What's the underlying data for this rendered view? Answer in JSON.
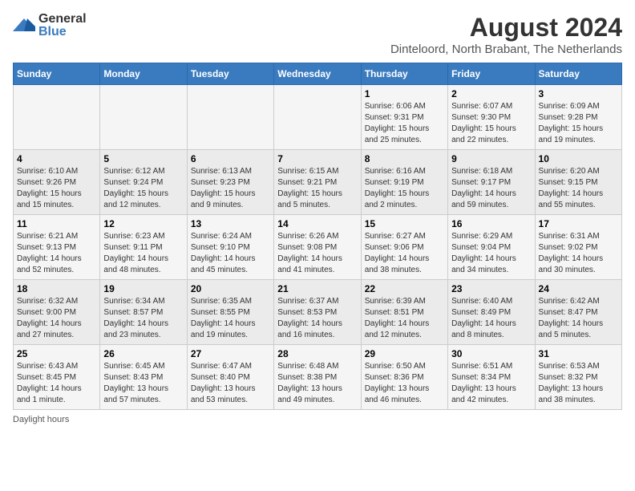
{
  "logo": {
    "general": "General",
    "blue": "Blue"
  },
  "title": "August 2024",
  "subtitle": "Dinteloord, North Brabant, The Netherlands",
  "weekdays": [
    "Sunday",
    "Monday",
    "Tuesday",
    "Wednesday",
    "Thursday",
    "Friday",
    "Saturday"
  ],
  "weeks": [
    [
      {
        "day": "",
        "info": ""
      },
      {
        "day": "",
        "info": ""
      },
      {
        "day": "",
        "info": ""
      },
      {
        "day": "",
        "info": ""
      },
      {
        "day": "1",
        "info": "Sunrise: 6:06 AM\nSunset: 9:31 PM\nDaylight: 15 hours and 25 minutes."
      },
      {
        "day": "2",
        "info": "Sunrise: 6:07 AM\nSunset: 9:30 PM\nDaylight: 15 hours and 22 minutes."
      },
      {
        "day": "3",
        "info": "Sunrise: 6:09 AM\nSunset: 9:28 PM\nDaylight: 15 hours and 19 minutes."
      }
    ],
    [
      {
        "day": "4",
        "info": "Sunrise: 6:10 AM\nSunset: 9:26 PM\nDaylight: 15 hours and 15 minutes."
      },
      {
        "day": "5",
        "info": "Sunrise: 6:12 AM\nSunset: 9:24 PM\nDaylight: 15 hours and 12 minutes."
      },
      {
        "day": "6",
        "info": "Sunrise: 6:13 AM\nSunset: 9:23 PM\nDaylight: 15 hours and 9 minutes."
      },
      {
        "day": "7",
        "info": "Sunrise: 6:15 AM\nSunset: 9:21 PM\nDaylight: 15 hours and 5 minutes."
      },
      {
        "day": "8",
        "info": "Sunrise: 6:16 AM\nSunset: 9:19 PM\nDaylight: 15 hours and 2 minutes."
      },
      {
        "day": "9",
        "info": "Sunrise: 6:18 AM\nSunset: 9:17 PM\nDaylight: 14 hours and 59 minutes."
      },
      {
        "day": "10",
        "info": "Sunrise: 6:20 AM\nSunset: 9:15 PM\nDaylight: 14 hours and 55 minutes."
      }
    ],
    [
      {
        "day": "11",
        "info": "Sunrise: 6:21 AM\nSunset: 9:13 PM\nDaylight: 14 hours and 52 minutes."
      },
      {
        "day": "12",
        "info": "Sunrise: 6:23 AM\nSunset: 9:11 PM\nDaylight: 14 hours and 48 minutes."
      },
      {
        "day": "13",
        "info": "Sunrise: 6:24 AM\nSunset: 9:10 PM\nDaylight: 14 hours and 45 minutes."
      },
      {
        "day": "14",
        "info": "Sunrise: 6:26 AM\nSunset: 9:08 PM\nDaylight: 14 hours and 41 minutes."
      },
      {
        "day": "15",
        "info": "Sunrise: 6:27 AM\nSunset: 9:06 PM\nDaylight: 14 hours and 38 minutes."
      },
      {
        "day": "16",
        "info": "Sunrise: 6:29 AM\nSunset: 9:04 PM\nDaylight: 14 hours and 34 minutes."
      },
      {
        "day": "17",
        "info": "Sunrise: 6:31 AM\nSunset: 9:02 PM\nDaylight: 14 hours and 30 minutes."
      }
    ],
    [
      {
        "day": "18",
        "info": "Sunrise: 6:32 AM\nSunset: 9:00 PM\nDaylight: 14 hours and 27 minutes."
      },
      {
        "day": "19",
        "info": "Sunrise: 6:34 AM\nSunset: 8:57 PM\nDaylight: 14 hours and 23 minutes."
      },
      {
        "day": "20",
        "info": "Sunrise: 6:35 AM\nSunset: 8:55 PM\nDaylight: 14 hours and 19 minutes."
      },
      {
        "day": "21",
        "info": "Sunrise: 6:37 AM\nSunset: 8:53 PM\nDaylight: 14 hours and 16 minutes."
      },
      {
        "day": "22",
        "info": "Sunrise: 6:39 AM\nSunset: 8:51 PM\nDaylight: 14 hours and 12 minutes."
      },
      {
        "day": "23",
        "info": "Sunrise: 6:40 AM\nSunset: 8:49 PM\nDaylight: 14 hours and 8 minutes."
      },
      {
        "day": "24",
        "info": "Sunrise: 6:42 AM\nSunset: 8:47 PM\nDaylight: 14 hours and 5 minutes."
      }
    ],
    [
      {
        "day": "25",
        "info": "Sunrise: 6:43 AM\nSunset: 8:45 PM\nDaylight: 14 hours and 1 minute."
      },
      {
        "day": "26",
        "info": "Sunrise: 6:45 AM\nSunset: 8:43 PM\nDaylight: 13 hours and 57 minutes."
      },
      {
        "day": "27",
        "info": "Sunrise: 6:47 AM\nSunset: 8:40 PM\nDaylight: 13 hours and 53 minutes."
      },
      {
        "day": "28",
        "info": "Sunrise: 6:48 AM\nSunset: 8:38 PM\nDaylight: 13 hours and 49 minutes."
      },
      {
        "day": "29",
        "info": "Sunrise: 6:50 AM\nSunset: 8:36 PM\nDaylight: 13 hours and 46 minutes."
      },
      {
        "day": "30",
        "info": "Sunrise: 6:51 AM\nSunset: 8:34 PM\nDaylight: 13 hours and 42 minutes."
      },
      {
        "day": "31",
        "info": "Sunrise: 6:53 AM\nSunset: 8:32 PM\nDaylight: 13 hours and 38 minutes."
      }
    ]
  ],
  "footer": {
    "daylight_label": "Daylight hours"
  }
}
